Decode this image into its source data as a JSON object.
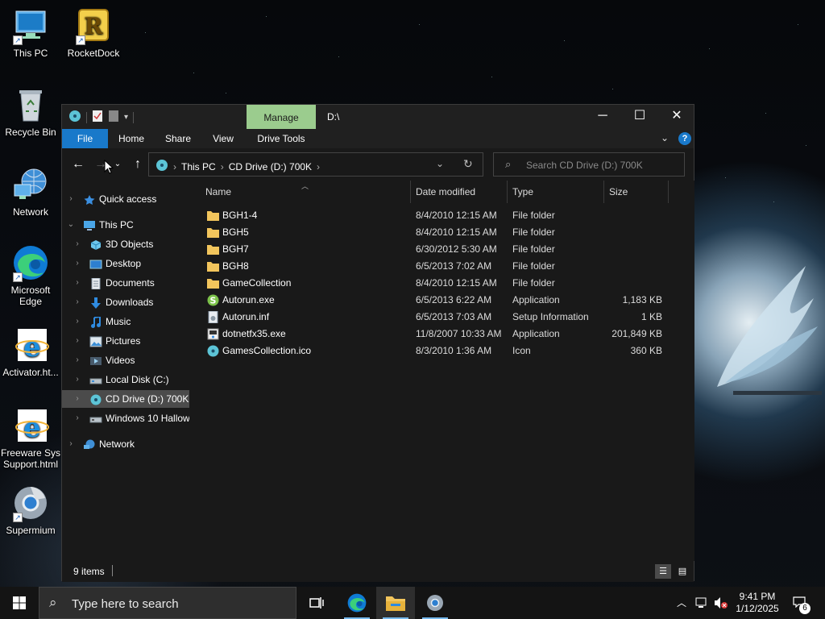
{
  "desktop": {
    "icons": [
      {
        "label": "This PC"
      },
      {
        "label": "RocketDock"
      },
      {
        "label": "Recycle Bin"
      },
      {
        "label": "Network"
      },
      {
        "label": "Microsoft Edge"
      },
      {
        "label": "Activator.ht..."
      },
      {
        "label": "Freeware Sys Support.html"
      },
      {
        "label": "Supermium"
      }
    ]
  },
  "window": {
    "title": "D:\\",
    "context_tab": "Manage",
    "ribbon_tabs": [
      "File",
      "Home",
      "Share",
      "View",
      "Drive Tools"
    ],
    "address": {
      "crumbs": [
        "This PC",
        "CD Drive (D:) 700K"
      ]
    },
    "search": {
      "placeholder": "Search CD Drive (D:) 700K"
    },
    "nav": {
      "items": [
        {
          "label": "Quick access",
          "icon": "star-icon"
        },
        {
          "label": "This PC",
          "icon": "monitor-icon"
        },
        {
          "label": "3D Objects",
          "icon": "cube-icon"
        },
        {
          "label": "Desktop",
          "icon": "desktop-icon"
        },
        {
          "label": "Documents",
          "icon": "documents-icon"
        },
        {
          "label": "Downloads",
          "icon": "download-arrow-icon"
        },
        {
          "label": "Music",
          "icon": "music-note-icon"
        },
        {
          "label": "Pictures",
          "icon": "pictures-icon"
        },
        {
          "label": "Videos",
          "icon": "videos-icon"
        },
        {
          "label": "Local Disk (C:)",
          "icon": "drive-icon"
        },
        {
          "label": "CD Drive (D:) 700K",
          "icon": "cd-drive-icon"
        },
        {
          "label": "Windows 10 Hallow",
          "icon": "drive-icon"
        },
        {
          "label": "Network",
          "icon": "network-icon"
        }
      ]
    },
    "columns": [
      "Name",
      "Date modified",
      "Type",
      "Size"
    ],
    "files": [
      {
        "name": "BGH1-4",
        "date": "8/4/2010 12:15 AM",
        "type": "File folder",
        "size": "",
        "icon": "folder-icon"
      },
      {
        "name": "BGH5",
        "date": "8/4/2010 12:15 AM",
        "type": "File folder",
        "size": "",
        "icon": "folder-icon"
      },
      {
        "name": "BGH7",
        "date": "6/30/2012 5:30 AM",
        "type": "File folder",
        "size": "",
        "icon": "folder-icon"
      },
      {
        "name": "BGH8",
        "date": "6/5/2013 7:02 AM",
        "type": "File folder",
        "size": "",
        "icon": "folder-icon"
      },
      {
        "name": "GameCollection",
        "date": "8/4/2010 12:15 AM",
        "type": "File folder",
        "size": "",
        "icon": "folder-icon"
      },
      {
        "name": "Autorun.exe",
        "date": "6/5/2013 6:22 AM",
        "type": "Application",
        "size": "1,183 KB",
        "icon": "application-icon"
      },
      {
        "name": "Autorun.inf",
        "date": "6/5/2013 7:03 AM",
        "type": "Setup Information",
        "size": "1 KB",
        "icon": "setup-file-icon"
      },
      {
        "name": "dotnetfx35.exe",
        "date": "11/8/2007 10:33 AM",
        "type": "Application",
        "size": "201,849 KB",
        "icon": "installer-icon"
      },
      {
        "name": "GamesCollection.ico",
        "date": "8/3/2010 1:36 AM",
        "type": "Icon",
        "size": "360 KB",
        "icon": "ico-file-icon"
      }
    ],
    "status": {
      "item_count": "9 items"
    }
  },
  "taskbar": {
    "search_placeholder": "Type here to search",
    "clock": {
      "time": "9:41 PM",
      "date": "1/12/2025"
    },
    "notification_count": "6"
  },
  "colors": {
    "accent": "#1979ca",
    "manage_tab": "#9bcc8e",
    "folder": "#f2c55c",
    "window_bg": "#191919"
  }
}
